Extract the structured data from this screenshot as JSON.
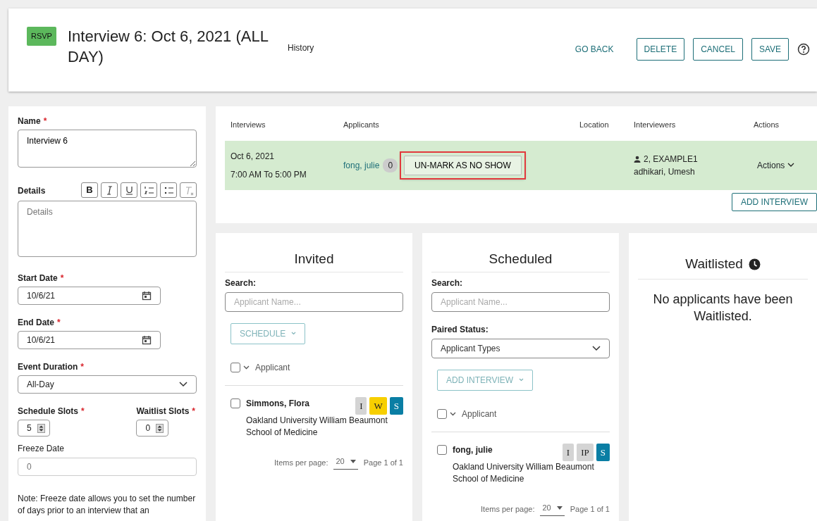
{
  "header": {
    "badge": "RSVP",
    "title": "Interview 6: Oct 6, 2021 (ALL DAY)",
    "history_link": "History",
    "buttons": [
      {
        "label": "GO BACK",
        "kind": "link"
      },
      {
        "label": "DELETE",
        "kind": "outline"
      },
      {
        "label": "CANCEL",
        "kind": "outline"
      },
      {
        "label": "SAVE",
        "kind": "outline"
      }
    ]
  },
  "form": {
    "name": {
      "label": "Name",
      "required": true,
      "value": "Interview 6"
    },
    "required_mark": "*",
    "details": {
      "label": "Details",
      "placeholder": "Details",
      "toolbar": [
        {
          "kind": "bold",
          "label": "B"
        },
        {
          "kind": "italic"
        },
        {
          "kind": "underline"
        },
        {
          "kind": "numbered_list"
        },
        {
          "kind": "bullet_list"
        },
        {
          "kind": "clear_format"
        }
      ]
    },
    "start_date": {
      "label": "Start Date",
      "required": true,
      "value": "10/6/21"
    },
    "end_date": {
      "label": "End Date",
      "required": true,
      "value": "10/6/21"
    },
    "event_duration": {
      "label": "Event Duration",
      "required": true,
      "value": "All-Day"
    },
    "schedule_slots": {
      "label": "Schedule Slots",
      "required": true,
      "value": "5"
    },
    "waitlist_slots": {
      "label": "Waitlist Slots",
      "required": true,
      "value": "0"
    },
    "freeze_date": {
      "label": "Freeze Date",
      "required": false,
      "placeholder": "0"
    },
    "note": "Note: Freeze date allows you to set the number of days prior to an interview that an"
  },
  "interviews": {
    "columns": [
      "Interviews",
      "Applicants",
      "Location",
      "Interviewers",
      "Actions"
    ],
    "rows": [
      {
        "date": "Oct 6, 2021",
        "time": "7:00 AM To 5:00 PM",
        "applicant": "fong, julie",
        "count": "0",
        "action_button": "UN-MARK AS NO SHOW",
        "highlighted": true,
        "interviewers": [
          "2, EXAMPLE1",
          "adhikari, Umesh"
        ],
        "actions": "Actions",
        "selected": true
      }
    ],
    "add_button": "ADD INTERVIEW"
  },
  "invited": {
    "title": "Invited",
    "search_label": "Search:",
    "search_placeholder": "Applicant Name...",
    "action_button": "SCHEDULE",
    "header_label": "Applicant",
    "all_checked": false,
    "applicants": [
      {
        "name": "Simmons, Flora",
        "school": "Oakland University William Beaumont School of Medicine",
        "checked": false,
        "badges": [
          {
            "label": "I",
            "color": "#d4d4d4"
          },
          {
            "label": "W",
            "color": "#f7cf00"
          },
          {
            "label": "S",
            "color": "#0a7ea4"
          }
        ]
      }
    ],
    "pagination": {
      "label": "Items per page:",
      "value": "20",
      "page": "Page 1 of 1"
    }
  },
  "scheduled": {
    "title": "Scheduled",
    "search_label": "Search:",
    "search_placeholder": "Applicant Name...",
    "paired_status": {
      "label": "Paired Status:",
      "value": "Applicant Types"
    },
    "action_button": "ADD INTERVIEW",
    "header_label": "Applicant",
    "all_checked": false,
    "applicants": [
      {
        "name": "fong, julie",
        "school": "Oakland University William Beaumont School of Medicine",
        "checked": false,
        "badges": [
          {
            "label": "I",
            "color": "#d4d4d4"
          },
          {
            "label": "IP",
            "color": "#d4d4d4"
          },
          {
            "label": "S",
            "color": "#0a7ea4"
          }
        ]
      }
    ],
    "pagination": {
      "label": "Items per page:",
      "value": "20",
      "page": "Page 1 of 1"
    }
  },
  "waitlisted": {
    "title": "Waitlisted",
    "empty_message": "No applicants have been Waitlisted."
  }
}
